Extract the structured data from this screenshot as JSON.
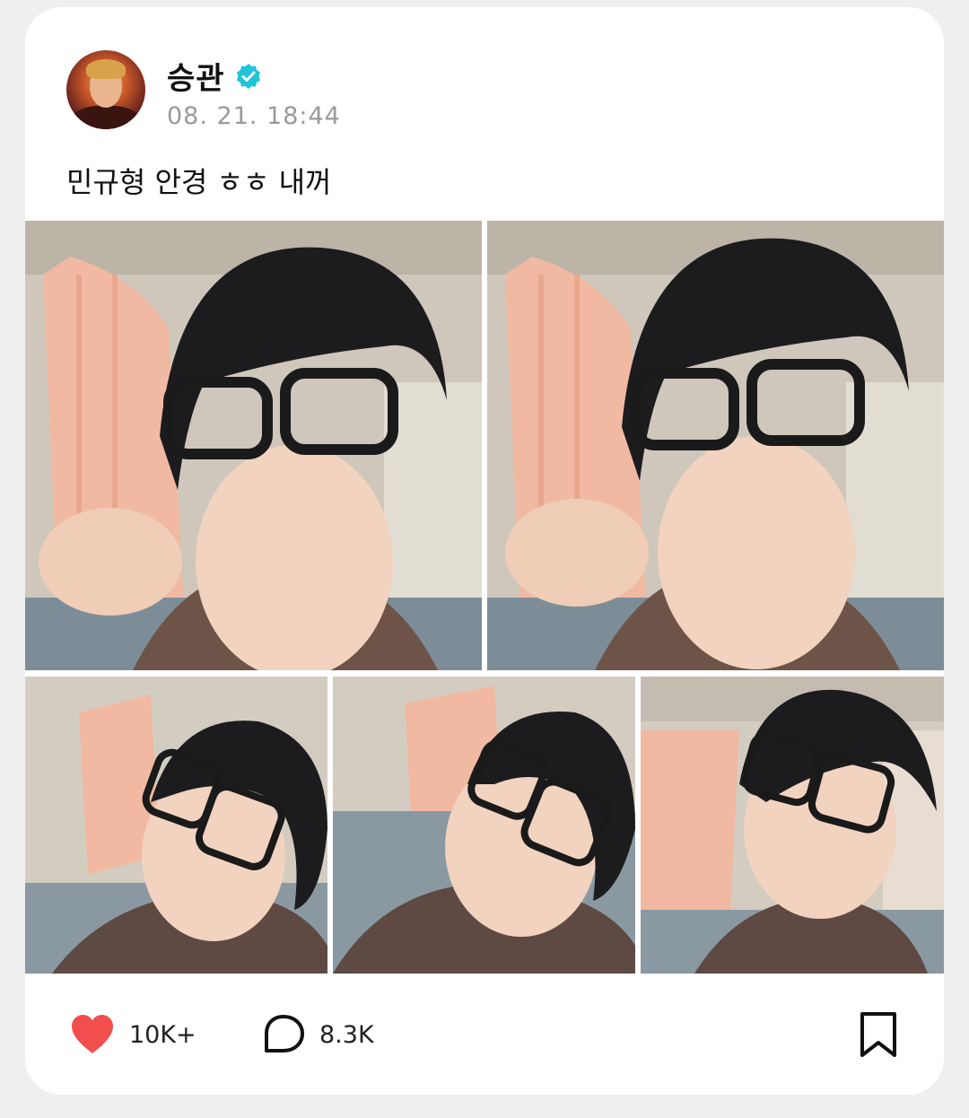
{
  "post": {
    "author": {
      "name": "승관",
      "verified_icon": "verified-badge-icon",
      "avatar_icon": "profile-avatar"
    },
    "timestamp": "08. 21. 18:44",
    "caption": "민규형 안경 ㅎㅎ 내꺼",
    "photos": [
      {
        "icon": "selfie-photo-1"
      },
      {
        "icon": "selfie-photo-2"
      },
      {
        "icon": "selfie-photo-3"
      },
      {
        "icon": "selfie-photo-4"
      },
      {
        "icon": "selfie-photo-5"
      }
    ]
  },
  "actions": {
    "like_count": "10K+",
    "comment_count": "8.3K",
    "like_icon": "heart-icon",
    "comment_icon": "speech-bubble-icon",
    "bookmark_icon": "bookmark-icon"
  },
  "colors": {
    "background": "#efefef",
    "card": "#ffffff",
    "heart": "#f24e4e",
    "verified": "#1fc4d8",
    "timestamp": "#9a9a9a"
  }
}
